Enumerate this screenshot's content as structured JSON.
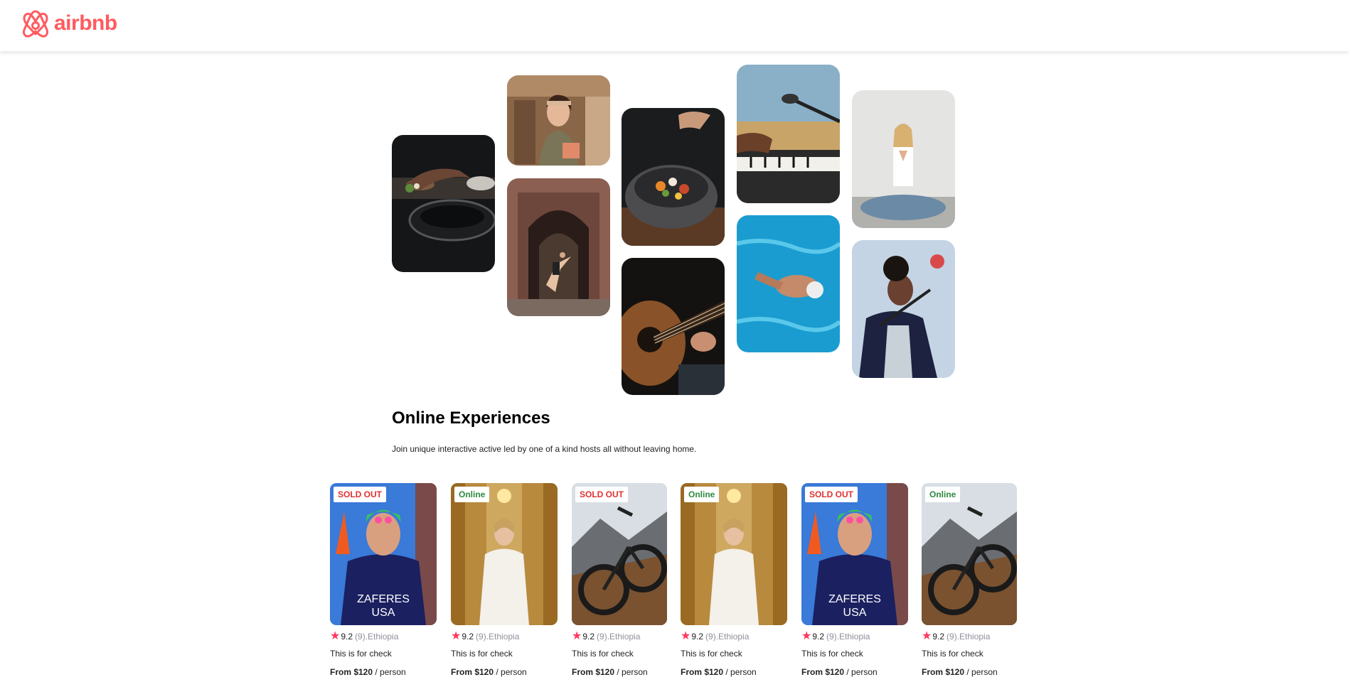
{
  "brand": {
    "name": "airbnb",
    "color": "#FF5A5F"
  },
  "hero": {
    "title": "Online Experiences",
    "text": "Join unique interactive active led by one of a kind hosts all without leaving home."
  },
  "photos": [
    "cooking-hands",
    "woman-in-kitchen",
    "ballet-dancer-doorway",
    "food-bowl",
    "acoustic-guitar",
    "piano-microphone",
    "swimmer-pool",
    "yoga-woman",
    "singer-microphone"
  ],
  "cards": [
    {
      "badge": "SOLD OUT",
      "status": "sold",
      "image": "swimmer-portrait",
      "star": "★",
      "rating": "9.2",
      "meta": "(9).Ethiopia",
      "title": "This is for check",
      "price": "From $120",
      "unit": " / person"
    },
    {
      "badge": "Online",
      "status": "online",
      "image": "bride-portrait",
      "star": "★",
      "rating": "9.2",
      "meta": "(9).Ethiopia",
      "title": "This is for check",
      "price": "From $120",
      "unit": " / person"
    },
    {
      "badge": "SOLD OUT",
      "status": "sold",
      "image": "mountain-bike",
      "star": "★",
      "rating": "9.2",
      "meta": "(9).Ethiopia",
      "title": "This is for check",
      "price": "From $120",
      "unit": " / person"
    },
    {
      "badge": "Online",
      "status": "online",
      "image": "bride-portrait",
      "star": "★",
      "rating": "9.2",
      "meta": "(9).Ethiopia",
      "title": "This is for check",
      "price": "From $120",
      "unit": " / person"
    },
    {
      "badge": "SOLD OUT",
      "status": "sold",
      "image": "swimmer-portrait",
      "star": "★",
      "rating": "9.2",
      "meta": "(9).Ethiopia",
      "title": "This is for check",
      "price": "From $120",
      "unit": " / person"
    },
    {
      "badge": "Online",
      "status": "online",
      "image": "mountain-bike",
      "star": "★",
      "rating": "9.2",
      "meta": "(9).Ethiopia",
      "title": "This is for check",
      "price": "From $120",
      "unit": " / person"
    }
  ],
  "colors": {
    "accent": "#FF5A5F",
    "star": "#FE385C",
    "sold": "#E03131",
    "online": "#2B8A3E",
    "muted": "#918E9B"
  }
}
